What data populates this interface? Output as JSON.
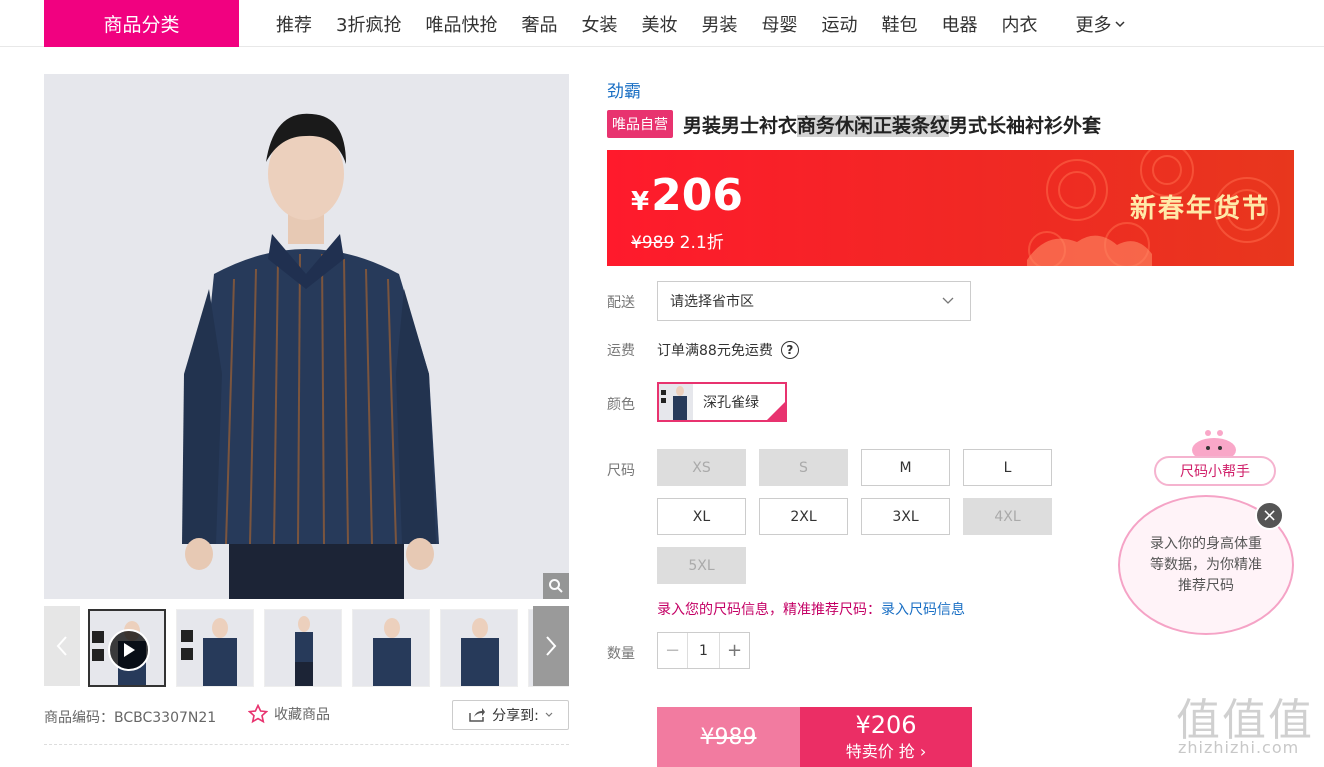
{
  "nav": {
    "category_label": "商品分类",
    "items": [
      "推荐",
      "3折疯抢",
      "唯品快抢",
      "奢品",
      "女装",
      "美妆",
      "男装",
      "母婴",
      "运动",
      "鞋包",
      "电器",
      "内衣"
    ],
    "more_label": "更多"
  },
  "gallery": {
    "thumb_count": 6,
    "icons": [
      "zoom-icon",
      "play-icon",
      "chevron-left-icon",
      "chevron-right-icon"
    ]
  },
  "meta": {
    "sku": "商品编码：BCBC3307N21",
    "favorite_label": "收藏商品",
    "share_label": "分享到:"
  },
  "product": {
    "brand": "劲霸",
    "tag": "唯品自营",
    "title_pre": "男装男士衬衣",
    "title_hl": "商务休闲正装条纹",
    "title_post": "男式长袖衬衫外套"
  },
  "banner": {
    "currency": "¥",
    "price": "206",
    "original_price": "¥989",
    "discount": "2.1折",
    "festival": "新春年货节"
  },
  "delivery": {
    "label": "配送",
    "placeholder": "请选择省市区"
  },
  "shipping": {
    "label": "运费",
    "text": "订单满88元免运费"
  },
  "color": {
    "label": "颜色",
    "selected": "深孔雀绿"
  },
  "size": {
    "label": "尺码",
    "options": [
      {
        "name": "XS",
        "available": false
      },
      {
        "name": "S",
        "available": false
      },
      {
        "name": "M",
        "available": true
      },
      {
        "name": "L",
        "available": true
      },
      {
        "name": "XL",
        "available": true
      },
      {
        "name": "2XL",
        "available": true
      },
      {
        "name": "3XL",
        "available": true
      },
      {
        "name": "4XL",
        "available": false
      },
      {
        "name": "5XL",
        "available": false
      }
    ],
    "hint": "录入您的尺码信息，精准推荐尺码：",
    "hint_link": "录入尺码信息"
  },
  "quantity": {
    "label": "数量",
    "value": "1",
    "minus": "−",
    "plus": "+"
  },
  "buy": {
    "original": "¥989",
    "price": "¥206",
    "action": "特卖价 抢 ›"
  },
  "helper": {
    "tag": "尺码小帮手",
    "bubble": "录入你的身高体重等数据，为你精准推荐尺码",
    "close": "×"
  },
  "watermark": {
    "main": "值值值",
    "sub": "zhizhizhi.com"
  },
  "colors": {
    "brand_pink": "#f10180",
    "accent_red": "#eb2e65",
    "link_blue": "#1a6fc4"
  }
}
